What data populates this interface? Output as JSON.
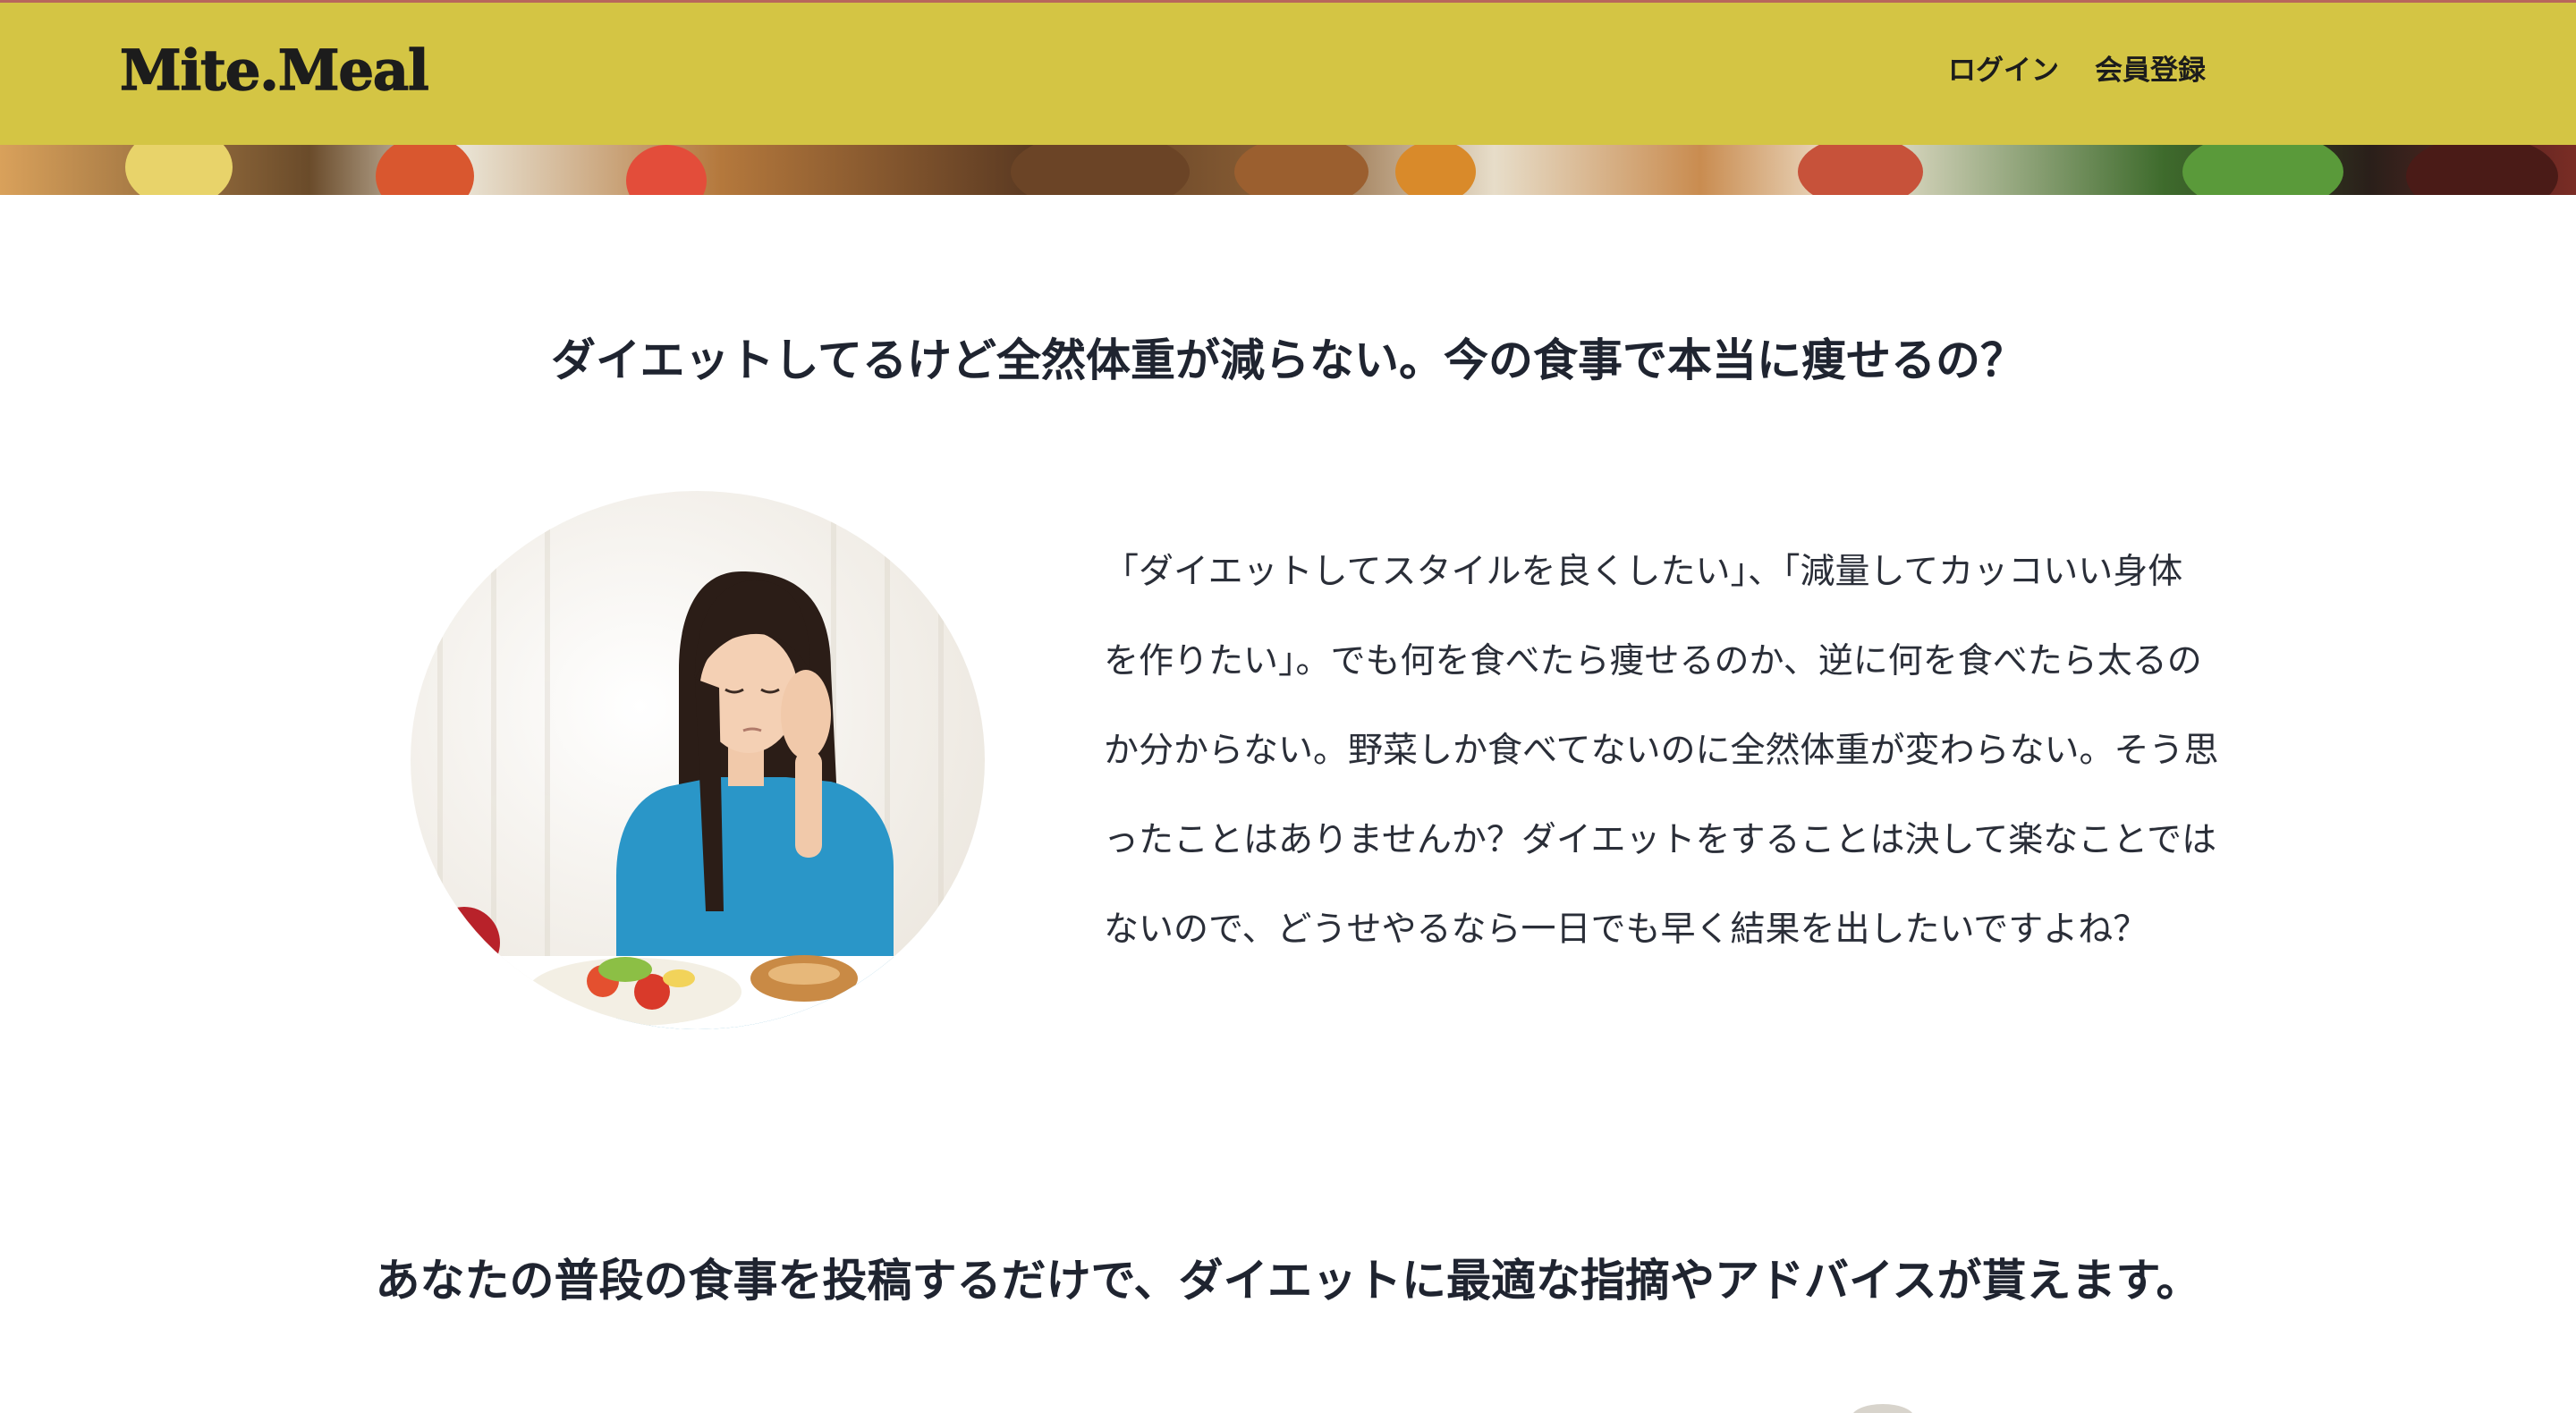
{
  "header": {
    "logo": "Mite.Meal",
    "nav": {
      "login": "ログイン",
      "signup": "会員登録"
    }
  },
  "colors": {
    "header_bg": "#d4c544",
    "text": "#1f2430"
  },
  "section1": {
    "headline": "ダイエットしてるけど全然体重が減らない。今の食事で本当に痩せるの？",
    "image_icon": "woman-worried-with-food-photo",
    "paragraph_lines": [
      "「ダイエットしてスタイルを良くしたい」、「減量してカッコいい身体",
      "を作りたい」。でも何を食べたら痩せるのか、逆に何を食べたら太るの",
      "か分からない。野菜しか食べてないのに全然体重が変わらない。そう思",
      "ったことはありませんか？ダイエットをすることは決して楽なことでは",
      "ないので、どうせやるなら一日でも早く結果を出したいですよね？"
    ]
  },
  "section2": {
    "headline": "あなたの普段の食事を投稿するだけで、ダイエットに最適な指摘やアドバイスが貰えます。"
  }
}
